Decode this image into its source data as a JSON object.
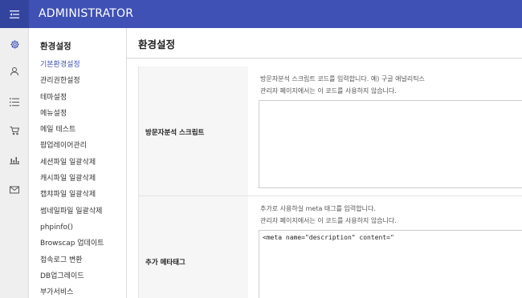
{
  "header": {
    "title": "ADMINISTRATOR",
    "menu_icon": "menu-collapse-icon"
  },
  "iconbar": {
    "items": [
      {
        "icon": "gear-icon",
        "active": true
      },
      {
        "icon": "user-icon"
      },
      {
        "icon": "list-icon"
      },
      {
        "icon": "cart-icon"
      },
      {
        "icon": "bar-chart-icon"
      },
      {
        "icon": "mail-icon"
      }
    ]
  },
  "submenu": {
    "title": "환경설정",
    "items": [
      "기본환경설정",
      "관리권한설정",
      "테마설정",
      "메뉴설정",
      "메일 테스트",
      "팝업레이어관리",
      "세션파일 일괄삭제",
      "캐시파일 일괄삭제",
      "캡챠파일 일괄삭제",
      "썸네일파일 일괄삭제",
      "phpinfo()",
      "Browscap 업데이트",
      "접속로그 변환",
      "DB업그레이드",
      "부가서비스"
    ],
    "active_index": 0
  },
  "main": {
    "title": "환경설정",
    "rows": [
      {
        "label": "방문자분석 스크립트",
        "help_line1": "방문자분석 스크립트 코드를 입력합니다. 예) 구글 애널리틱스",
        "help_line2": "관리자 페이지에서는 이 코드를 사용하지 않습니다.",
        "value": ""
      },
      {
        "label": "추가 메타태그",
        "help_line1": "추가로 사용하실 meta 태그를 입력합니다.",
        "help_line2": "관리자 페이지에서는 이 코드를 사용하지 않습니다.",
        "value": "<meta name=\"description\" content=\""
      }
    ]
  },
  "colors": {
    "primary": "#3f51b5",
    "primary_dark": "#33449f",
    "sidebar_bg": "#efefef",
    "label_bg": "#f6f6f6"
  }
}
